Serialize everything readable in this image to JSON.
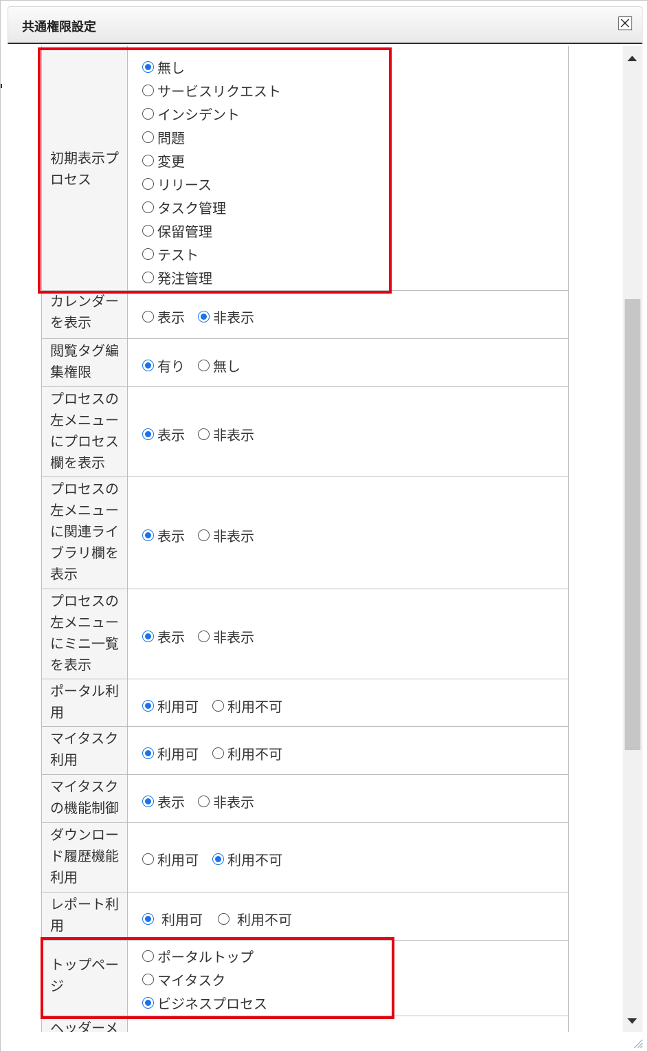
{
  "dialog": {
    "title": "共通権限設定"
  },
  "icons": {
    "close": "close-icon",
    "scroll_up": "arrow-up-icon",
    "scroll_down": "arrow-down-icon",
    "resize": "resize-grip-icon"
  },
  "colors": {
    "accent": "#1a73e8",
    "highlight": "#e60012",
    "label_bg": "#f5f5f5",
    "border": "#bdbdbd"
  },
  "rows": [
    {
      "label": "初期表示プロセス",
      "options": [
        {
          "label": "無し",
          "checked": true
        },
        {
          "label": "サービスリクエスト",
          "checked": false
        },
        {
          "label": "インシデント",
          "checked": false
        },
        {
          "label": "問題",
          "checked": false
        },
        {
          "label": "変更",
          "checked": false
        },
        {
          "label": "リリース",
          "checked": false
        },
        {
          "label": "タスク管理",
          "checked": false
        },
        {
          "label": "保留管理",
          "checked": false
        },
        {
          "label": "テスト",
          "checked": false
        },
        {
          "label": "発注管理",
          "checked": false
        }
      ]
    },
    {
      "label": "カレンダーを表示",
      "options": [
        {
          "label": "表示",
          "checked": false
        },
        {
          "label": "非表示",
          "checked": true
        }
      ]
    },
    {
      "label": "閲覧タグ編集権限",
      "options": [
        {
          "label": "有り",
          "checked": true
        },
        {
          "label": "無し",
          "checked": false
        }
      ]
    },
    {
      "label": "プロセスの左メニューにプロセス欄を表示",
      "options": [
        {
          "label": "表示",
          "checked": true
        },
        {
          "label": "非表示",
          "checked": false
        }
      ]
    },
    {
      "label": "プロセスの左メニューに関連ライブラリ欄を表示",
      "options": [
        {
          "label": "表示",
          "checked": true
        },
        {
          "label": "非表示",
          "checked": false
        }
      ]
    },
    {
      "label": "プロセスの左メニューにミニ一覧を表示",
      "options": [
        {
          "label": "表示",
          "checked": true
        },
        {
          "label": "非表示",
          "checked": false
        }
      ]
    },
    {
      "label": "ポータル利用",
      "options": [
        {
          "label": "利用可",
          "checked": true
        },
        {
          "label": "利用不可",
          "checked": false
        }
      ]
    },
    {
      "label": "マイタスク利用",
      "options": [
        {
          "label": "利用可",
          "checked": true
        },
        {
          "label": "利用不可",
          "checked": false
        }
      ]
    },
    {
      "label": "マイタスクの機能制御",
      "options": [
        {
          "label": "表示",
          "checked": true
        },
        {
          "label": "非表示",
          "checked": false
        }
      ]
    },
    {
      "label": "ダウンロード履歴機能利用",
      "options": [
        {
          "label": "利用可",
          "checked": false
        },
        {
          "label": "利用不可",
          "checked": true
        }
      ]
    },
    {
      "label": "レポート利用",
      "options": [
        {
          "label": "利用可",
          "checked": true
        },
        {
          "label": "利用不可",
          "checked": false
        }
      ]
    },
    {
      "label": "トップページ",
      "options": [
        {
          "label": "ポータルトップ",
          "checked": false
        },
        {
          "label": "マイタスク",
          "checked": false
        },
        {
          "label": "ビジネスプロセス",
          "checked": true
        }
      ]
    },
    {
      "label": "ヘッダーメ",
      "options": []
    }
  ]
}
